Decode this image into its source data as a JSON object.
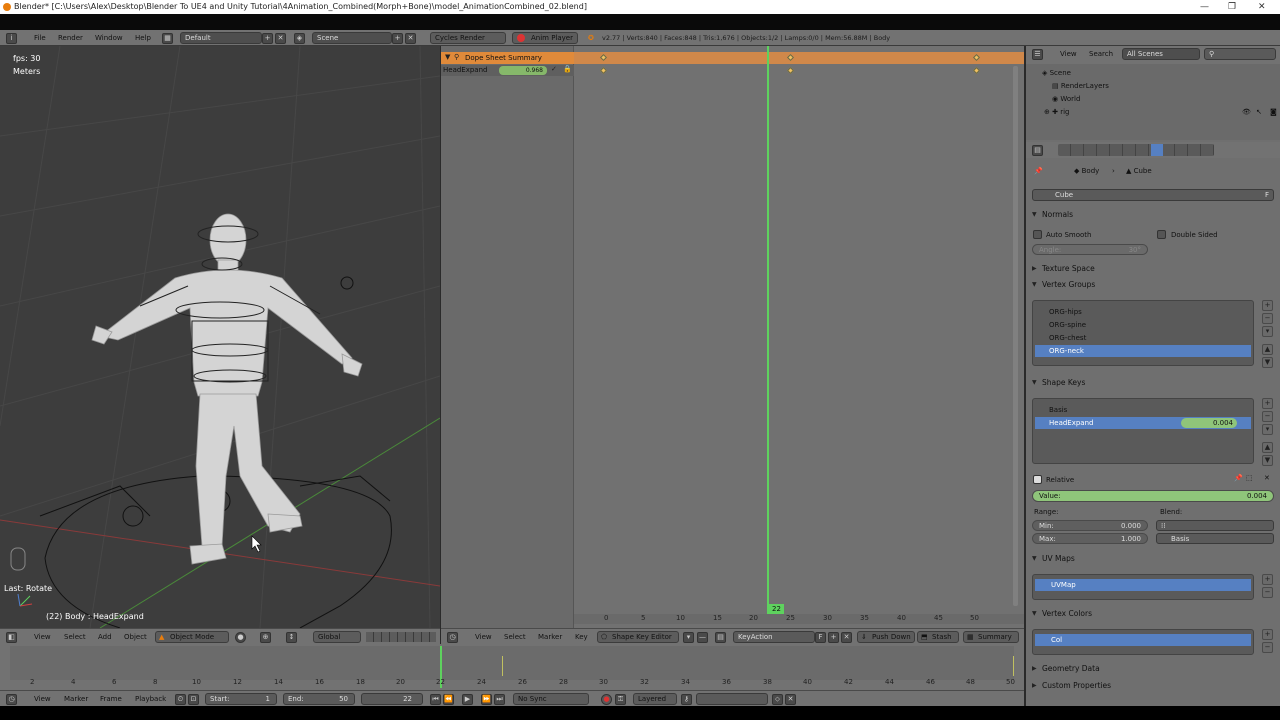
{
  "window": {
    "title": "Blender* [C:\\Users\\Alex\\Desktop\\Blender To UE4 and Unity Tutorial\\4Animation_Combined(Morph+Bone)\\model_AnimationCombined_02.blend]",
    "min": "—",
    "max": "❐",
    "close": "✕"
  },
  "info_header": {
    "menus": [
      "File",
      "Render",
      "Window",
      "Help"
    ],
    "layout": "Default",
    "scene": "Scene",
    "engine": "Cycles Render",
    "anim_player": "Anim Player",
    "stats": "v2.77 | Verts:840 | Faces:848 | Tris:1,676 | Objects:1/2 | Lamps:0/0 | Mem:56.88M | Body"
  },
  "viewport": {
    "fps": "fps: 30",
    "units": "Meters",
    "last_op": "Last: Rotate",
    "object_info": "(22) Body : HeadExpand",
    "header_menus": [
      "View",
      "Select",
      "Add",
      "Object"
    ],
    "mode": "Object Mode",
    "orientation": "Global"
  },
  "dopesheet": {
    "summary": "Dope Sheet Summary",
    "channel": "HeadExpand",
    "channel_value": "0.968",
    "current_frame": "22",
    "ruler": [
      "0",
      "5",
      "10",
      "15",
      "20",
      "25",
      "30",
      "35",
      "40",
      "45",
      "50"
    ],
    "header_menus": [
      "View",
      "Select",
      "Marker",
      "Key"
    ],
    "mode": "Shape Key Editor",
    "action": "KeyAction",
    "push_down": "Push Down",
    "stash": "Stash",
    "summary_btn": "Summary"
  },
  "timeline": {
    "ruler": [
      "2",
      "4",
      "6",
      "8",
      "10",
      "12",
      "14",
      "16",
      "18",
      "20",
      "22",
      "24",
      "26",
      "28",
      "30",
      "32",
      "34",
      "36",
      "38",
      "40",
      "42",
      "44",
      "46",
      "48",
      "50"
    ],
    "menus": [
      "View",
      "Marker",
      "Frame",
      "Playback"
    ],
    "start_label": "Start:",
    "start": "1",
    "end_label": "End:",
    "end": "50",
    "current": "22",
    "sync": "No Sync",
    "layered": "Layered"
  },
  "outliner": {
    "menus": [
      "View",
      "Search"
    ],
    "filter": "All Scenes",
    "items": [
      "Scene",
      "RenderLayers",
      "World",
      "rig"
    ]
  },
  "properties": {
    "breadcrumb_obj": "Body",
    "breadcrumb_mesh": "Cube",
    "mesh_name": "Cube",
    "mesh_fake": "F",
    "normals": "Normals",
    "auto_smooth": "Auto Smooth",
    "double_sided": "Double Sided",
    "angle_label": "Angle:",
    "angle_value": "30°",
    "texture_space": "Texture Space",
    "vertex_groups": "Vertex Groups",
    "vgroups": [
      "ORG-hips",
      "ORG-spine",
      "ORG-chest",
      "ORG-neck"
    ],
    "shape_keys": "Shape Keys",
    "skeys": [
      "Basis",
      "HeadExpand"
    ],
    "skey_value": "0.004",
    "relative": "Relative",
    "value_label": "Value:",
    "value": "0.004",
    "range": "Range:",
    "blend": "Blend:",
    "min_label": "Min:",
    "min": "0.000",
    "max_label": "Max:",
    "max": "1.000",
    "blend_value": "Basis",
    "uv_maps": "UV Maps",
    "uvmap": "UVMap",
    "vertex_colors": "Vertex Colors",
    "vcol": "Col",
    "geometry_data": "Geometry Data",
    "custom_props": "Custom Properties"
  }
}
